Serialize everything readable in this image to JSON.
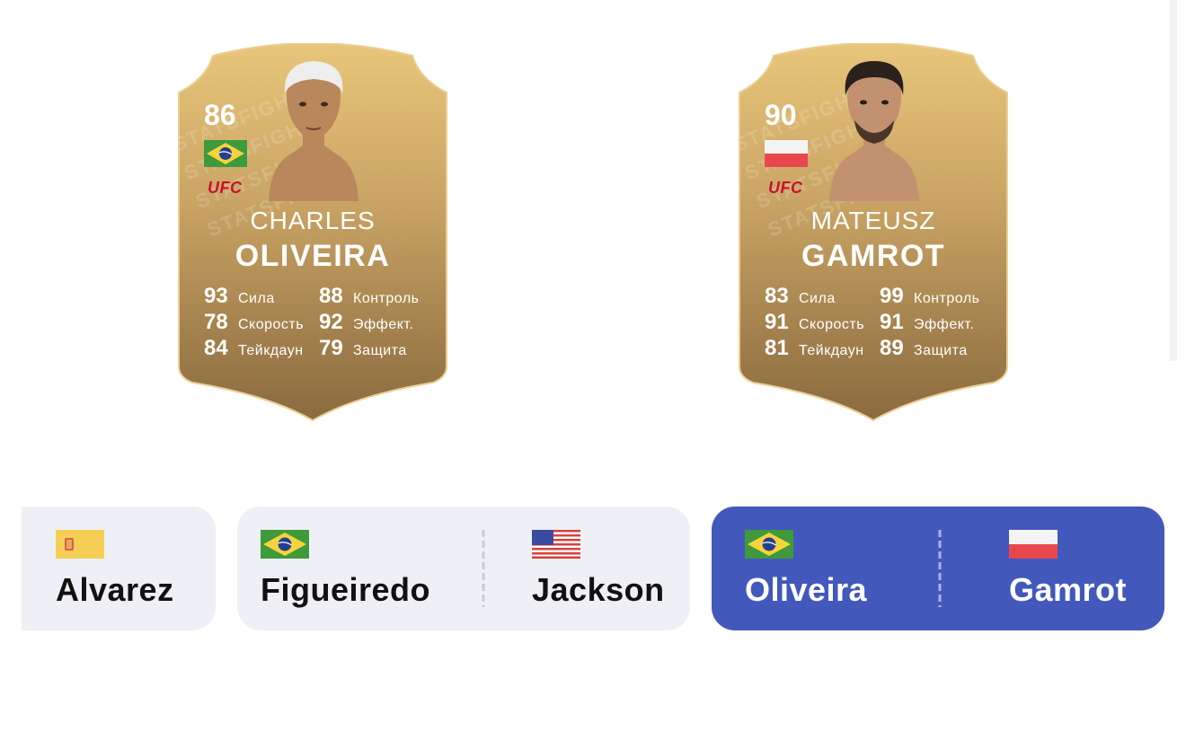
{
  "cards": [
    {
      "rating": "86",
      "flag": "brazil-flag",
      "league": "UFC",
      "first_name": "CHARLES",
      "last_name": "OLIVEIRA",
      "watermark": "STATSFIGHT",
      "stats": [
        {
          "value": "93",
          "label": "Сила"
        },
        {
          "value": "88",
          "label": "Контроль"
        },
        {
          "value": "78",
          "label": "Скорость"
        },
        {
          "value": "92",
          "label": "Эффект."
        },
        {
          "value": "84",
          "label": "Тейкдаун"
        },
        {
          "value": "79",
          "label": "Защита"
        }
      ]
    },
    {
      "rating": "90",
      "flag": "poland-flag",
      "league": "UFC",
      "first_name": "MATEUSZ",
      "last_name": "GAMROT",
      "watermark": "STATSFIGHT",
      "stats": [
        {
          "value": "83",
          "label": "Сила"
        },
        {
          "value": "99",
          "label": "Контроль"
        },
        {
          "value": "91",
          "label": "Скорость"
        },
        {
          "value": "91",
          "label": "Эффект."
        },
        {
          "value": "81",
          "label": "Тейкдаун"
        },
        {
          "value": "89",
          "label": "Защита"
        }
      ]
    }
  ],
  "fights": [
    {
      "active": false,
      "fighters": [
        {
          "name": "Alvarez",
          "flag": "spain-flag"
        }
      ]
    },
    {
      "active": false,
      "fighters": [
        {
          "name": "Figueiredo",
          "flag": "brazil-flag"
        },
        {
          "name": "Jackson",
          "flag": "usa-flag"
        }
      ]
    },
    {
      "active": true,
      "fighters": [
        {
          "name": "Oliveira",
          "flag": "brazil-flag"
        },
        {
          "name": "Gamrot",
          "flag": "poland-flag"
        }
      ]
    }
  ],
  "colors": {
    "card_gold": "#d9b56c",
    "card_dark": "#8b6b40",
    "chip_bg": "#eff0f5",
    "chip_active": "#4358bb",
    "ufc_red": "#c8102e"
  }
}
